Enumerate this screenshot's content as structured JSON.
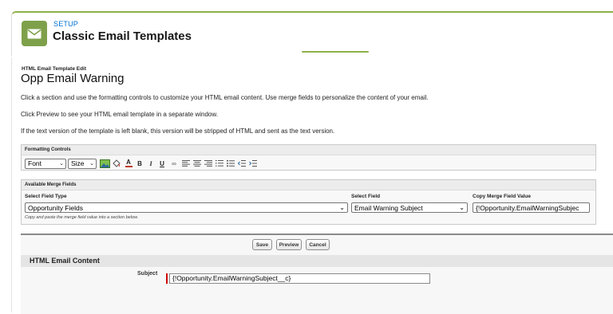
{
  "header": {
    "kicker": "SETUP",
    "title": "Classic Email Templates",
    "icon": "envelope-icon",
    "accent_color": "#7ea04a"
  },
  "page": {
    "kicker": "HTML Email Template Edit",
    "title": "Opp Email Warning",
    "intro_lines": [
      "Click a section and use the formatting controls to customize your HTML email content. Use merge fields to personalize the content of your email.",
      "Click Preview to see your HTML email template in a separate window.",
      "If the text version of the template is left blank, this version will be stripped of HTML and sent as the text version."
    ]
  },
  "formatting": {
    "header": "Formatting Controls",
    "font_value": "Font",
    "size_value": "Size",
    "tools": [
      "image-icon",
      "paint-bucket-icon",
      "font-color-icon",
      "bold-icon",
      "italic-icon",
      "underline-icon",
      "link-icon",
      "align-left-icon",
      "align-center-icon",
      "align-right-icon",
      "ordered-list-icon",
      "unordered-list-icon",
      "outdent-icon",
      "indent-icon"
    ]
  },
  "merge": {
    "header": "Available Merge Fields",
    "type_label": "Select Field Type",
    "type_value": "Opportunity Fields",
    "field_label": "Select Field",
    "field_value": "Email Warning Subject",
    "copy_label": "Copy Merge Field Value",
    "copy_value": "{!Opportunity.EmailWarningSubjec",
    "hint": "Copy and paste the merge field value into a section below."
  },
  "actions": {
    "save": "Save",
    "preview": "Preview",
    "cancel": "Cancel"
  },
  "content": {
    "section_title": "HTML Email Content",
    "subject_label": "Subject",
    "subject_value": "{!Opportunity.EmailWarningSubject__c}",
    "required_color": "#cc0000"
  }
}
